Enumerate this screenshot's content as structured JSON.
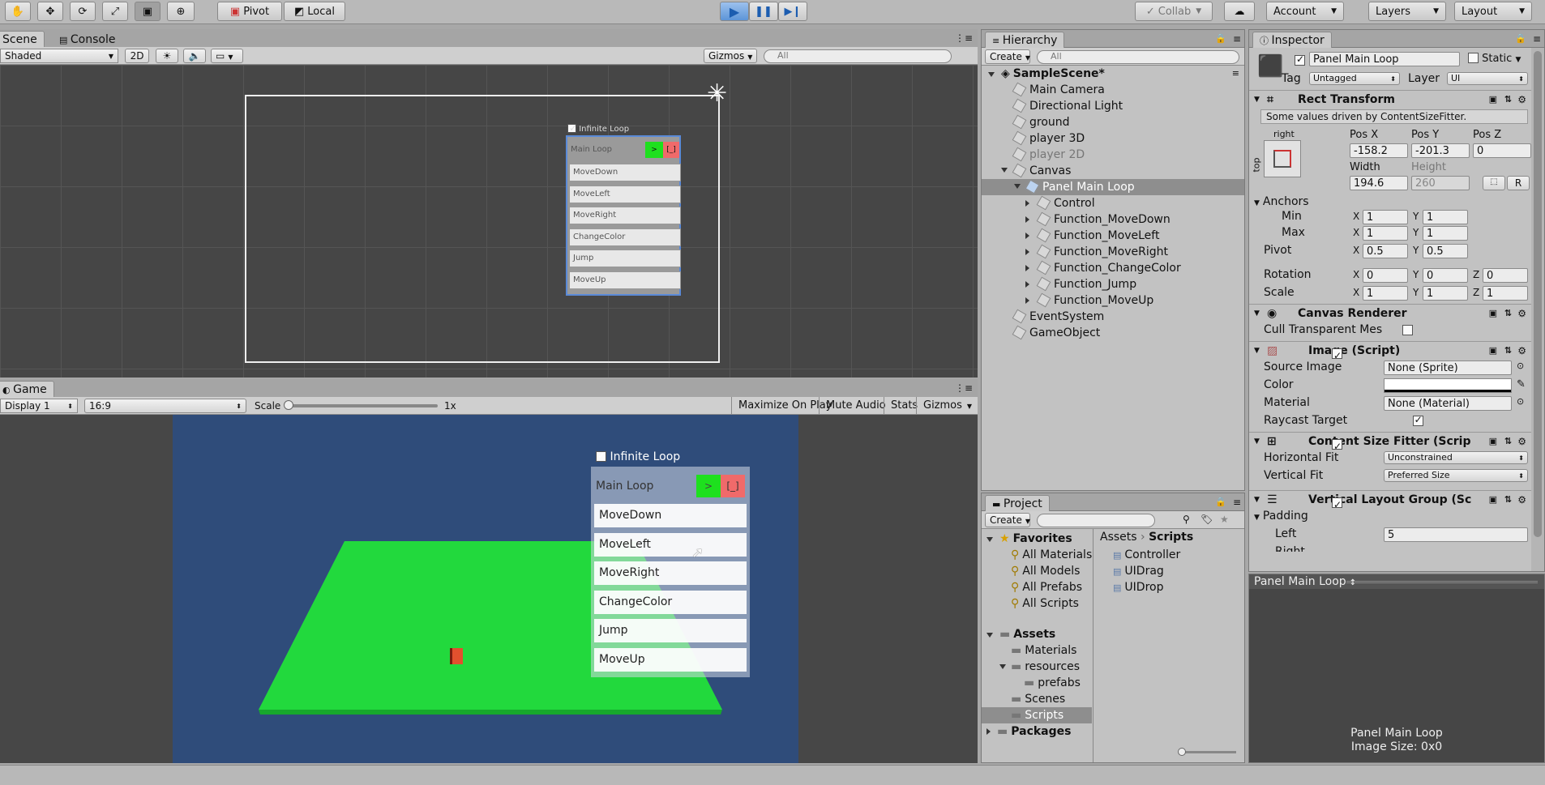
{
  "toolbar": {
    "pivot": "Pivot",
    "local": "Local",
    "collab": "Collab",
    "account": "Account",
    "layers": "Layers",
    "layout": "Layout",
    "accent": "#4a86d8"
  },
  "scene": {
    "tab_scene": "Scene",
    "tab_console": "Console",
    "shading": "Shaded",
    "mode_2d": "2D",
    "gizmos": "Gizmos",
    "search_placeholder": "All",
    "panel": {
      "toggle_label": "Infinite Loop",
      "header": "Main Loop",
      "run_btn": ">",
      "stop_btn": "[_]",
      "items": [
        "MoveDown",
        "MoveLeft",
        "MoveRight",
        "ChangeColor",
        "Jump",
        "MoveUp"
      ]
    }
  },
  "game": {
    "tab": "Game",
    "display": "Display 1",
    "aspect": "16:9",
    "scale_label": "Scale",
    "scale_value": "1x",
    "maximize": "Maximize On Play",
    "mute": "Mute Audio",
    "stats": "Stats",
    "gizmos": "Gizmos",
    "panel": {
      "toggle_label": "Infinite Loop",
      "header": "Main Loop",
      "run_btn": ">",
      "stop_btn": "[_]",
      "items": [
        "MoveDown",
        "MoveLeft",
        "MoveRight",
        "ChangeColor",
        "Jump",
        "MoveUp"
      ]
    }
  },
  "hierarchy": {
    "tab": "Hierarchy",
    "create": "Create",
    "search_placeholder": "All",
    "scene": "SampleScene*",
    "items": [
      {
        "label": "Main Camera"
      },
      {
        "label": "Directional Light"
      },
      {
        "label": "ground"
      },
      {
        "label": "player 3D"
      },
      {
        "label": "player 2D"
      },
      {
        "label": "Canvas"
      },
      {
        "label": "Panel Main Loop"
      },
      {
        "label": "Control"
      },
      {
        "label": "Function_MoveDown"
      },
      {
        "label": "Function_MoveLeft"
      },
      {
        "label": "Function_MoveRight"
      },
      {
        "label": "Function_ChangeColor"
      },
      {
        "label": "Function_Jump"
      },
      {
        "label": "Function_MoveUp"
      },
      {
        "label": "EventSystem"
      },
      {
        "label": "GameObject"
      }
    ]
  },
  "project": {
    "tab": "Project",
    "create": "Create",
    "favorites": "Favorites",
    "fav_items": [
      "All Materials",
      "All Models",
      "All Prefabs",
      "All Scripts"
    ],
    "assets": "Assets",
    "asset_items": [
      "Materials",
      "resources",
      "prefabs",
      "Scenes",
      "Scripts"
    ],
    "packages": "Packages",
    "breadcrumb_root": "Assets",
    "breadcrumb_current": "Scripts",
    "files": [
      "Controller",
      "UIDrag",
      "UIDrop"
    ]
  },
  "inspector": {
    "tab": "Inspector",
    "name": "Panel Main Loop",
    "static": "Static",
    "tag_label": "Tag",
    "tag": "Untagged",
    "layer_label": "Layer",
    "layer": "UI",
    "rect_transform": "Rect Transform",
    "driven_note": "Some values driven by ContentSizeFitter.",
    "anchor_h": "right",
    "anchor_v": "top",
    "pos_x_label": "Pos X",
    "pos_y_label": "Pos Y",
    "pos_z_label": "Pos Z",
    "pos_x": "-158.2",
    "pos_y": "-201.3",
    "pos_z": "0",
    "width_label": "Width",
    "height_label": "Height",
    "width": "194.6",
    "height": "260",
    "r_btn": "R",
    "anchors": "Anchors",
    "min": "Min",
    "max": "Max",
    "min_x": "1",
    "min_y": "1",
    "max_x": "1",
    "max_y": "1",
    "pivot": "Pivot",
    "pivot_x": "0.5",
    "pivot_y": "0.5",
    "rotation": "Rotation",
    "rot_x": "0",
    "rot_y": "0",
    "rot_z": "0",
    "scale": "Scale",
    "scale_x": "1",
    "scale_y": "1",
    "scale_z": "1",
    "x": "X",
    "y": "Y",
    "z": "Z",
    "canvas_renderer": "Canvas Renderer",
    "cull": "Cull Transparent Mes",
    "image_script": "Image (Script)",
    "source_image_label": "Source Image",
    "source_image": "None (Sprite)",
    "color_label": "Color",
    "material_label": "Material",
    "material": "None (Material)",
    "raycast_label": "Raycast Target",
    "csf": "Content Size Fitter (Scrip",
    "hfit_label": "Horizontal Fit",
    "hfit": "Unconstrained",
    "vfit_label": "Vertical Fit",
    "vfit": "Preferred Size",
    "vlg": "Vertical Layout Group (Sc",
    "padding": "Padding",
    "left_label": "Left",
    "left": "5",
    "right_partial": "Right",
    "preview_title": "Panel Main Loop",
    "preview_name": "Panel Main Loop",
    "preview_size": "Image Size: 0x0"
  }
}
